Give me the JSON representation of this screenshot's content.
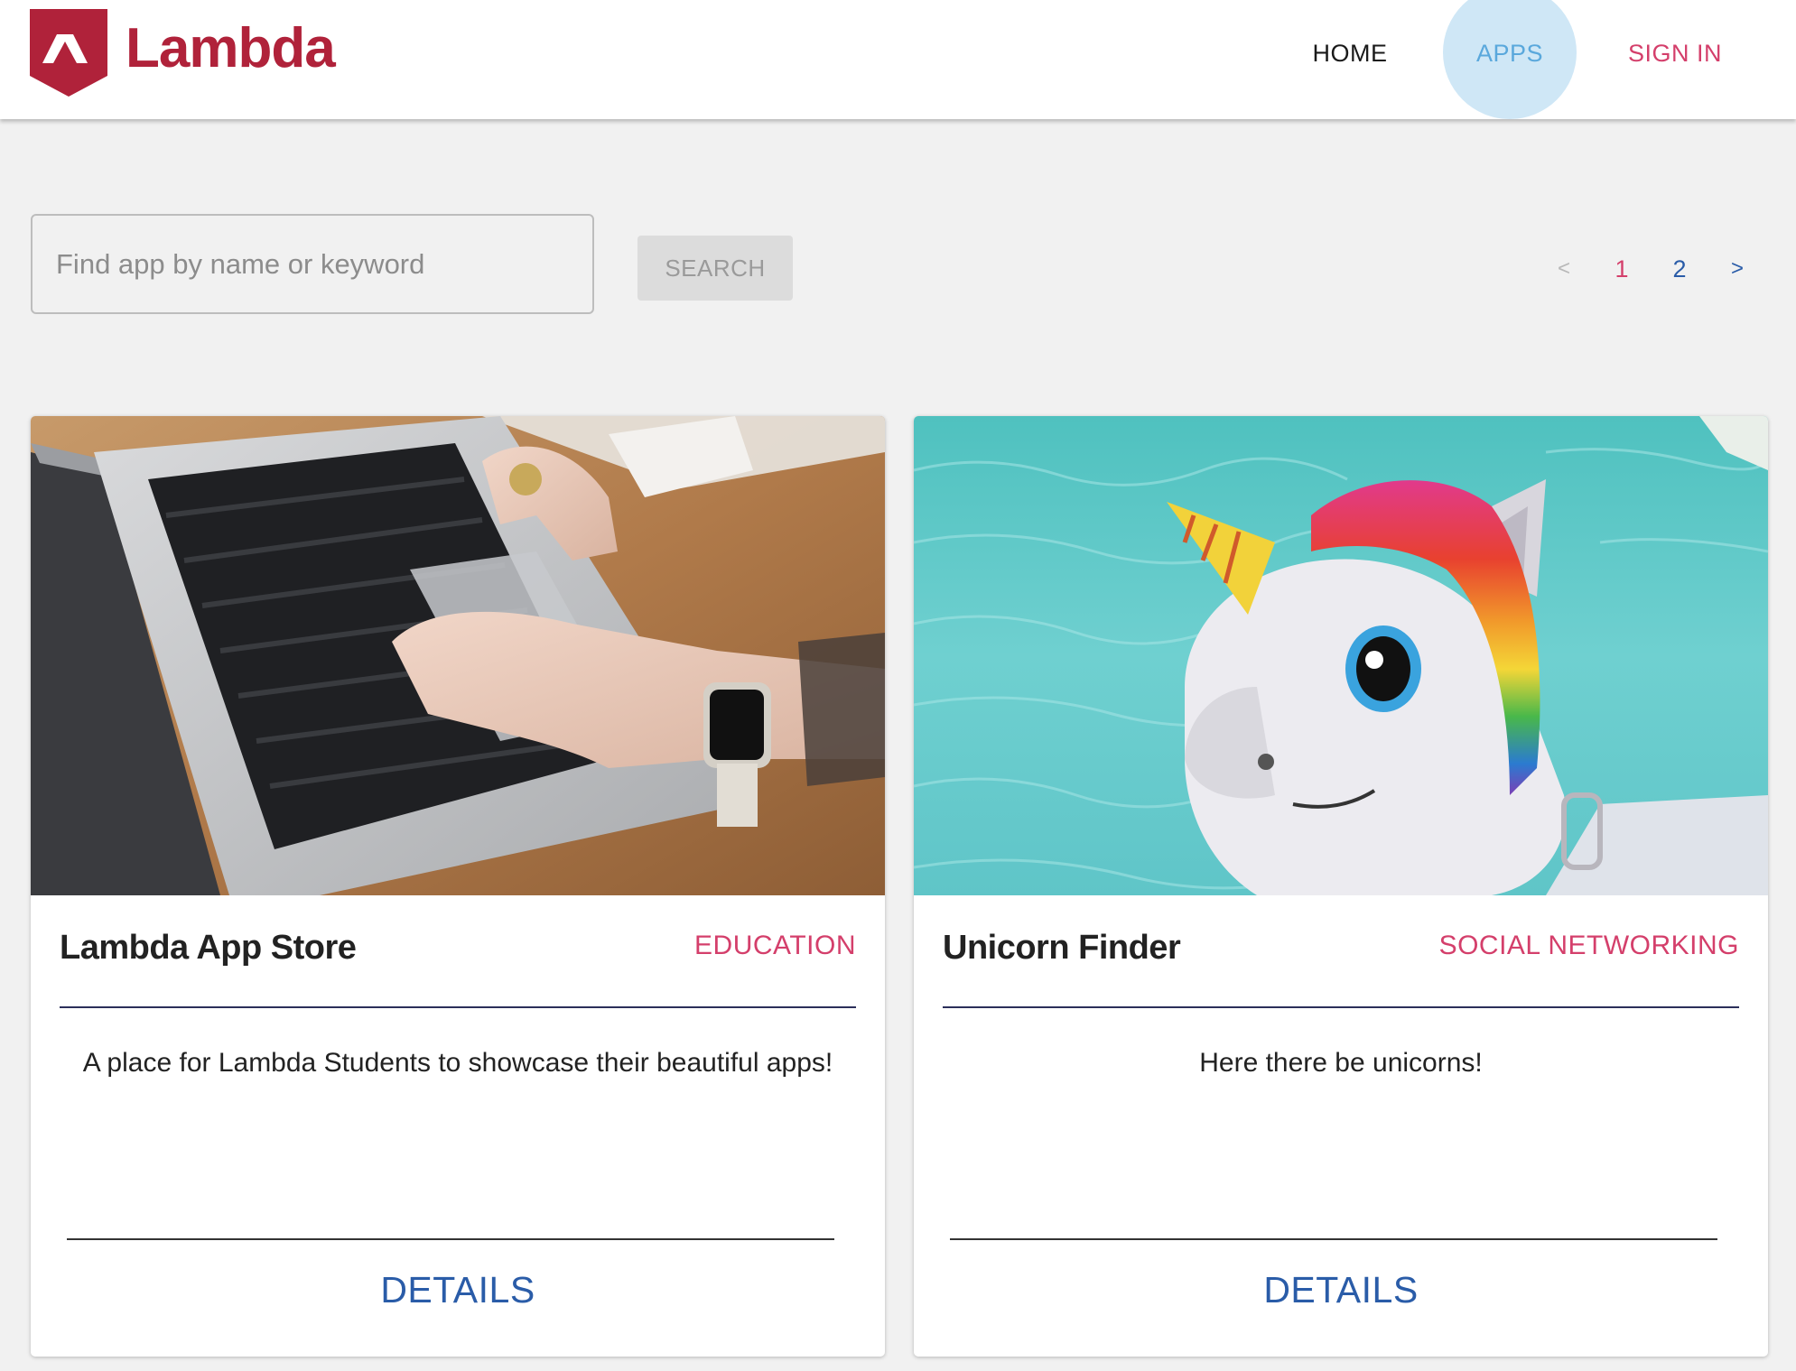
{
  "header": {
    "brand": "Lambda",
    "nav": {
      "home": "HOME",
      "apps": "APPS",
      "sign_in": "SIGN IN"
    }
  },
  "search": {
    "placeholder": "Find app by name or keyword",
    "value": "",
    "button_label": "SEARCH"
  },
  "pagination": {
    "prev": "<",
    "pages": [
      "1",
      "2"
    ],
    "current_page": "1",
    "next": ">"
  },
  "cards": [
    {
      "title": "Lambda App Store",
      "category": "EDUCATION",
      "description": "A place for Lambda Students to showcase their beautiful apps!",
      "action_label": "DETAILS",
      "image": "laptop-typing-photo"
    },
    {
      "title": "Unicorn Finder",
      "category": "SOCIAL NETWORKING",
      "description": "Here there be unicorns!",
      "action_label": "DETAILS",
      "image": "inflatable-unicorn-pool-photo"
    }
  ],
  "colors": {
    "brand_red": "#b0223a",
    "accent_pink": "#d43f6b",
    "link_blue": "#2a5ca8",
    "active_nav_blue": "#5aa8dc",
    "active_nav_highlight": "#cfe7f6",
    "page_background": "#f1f1f1"
  }
}
